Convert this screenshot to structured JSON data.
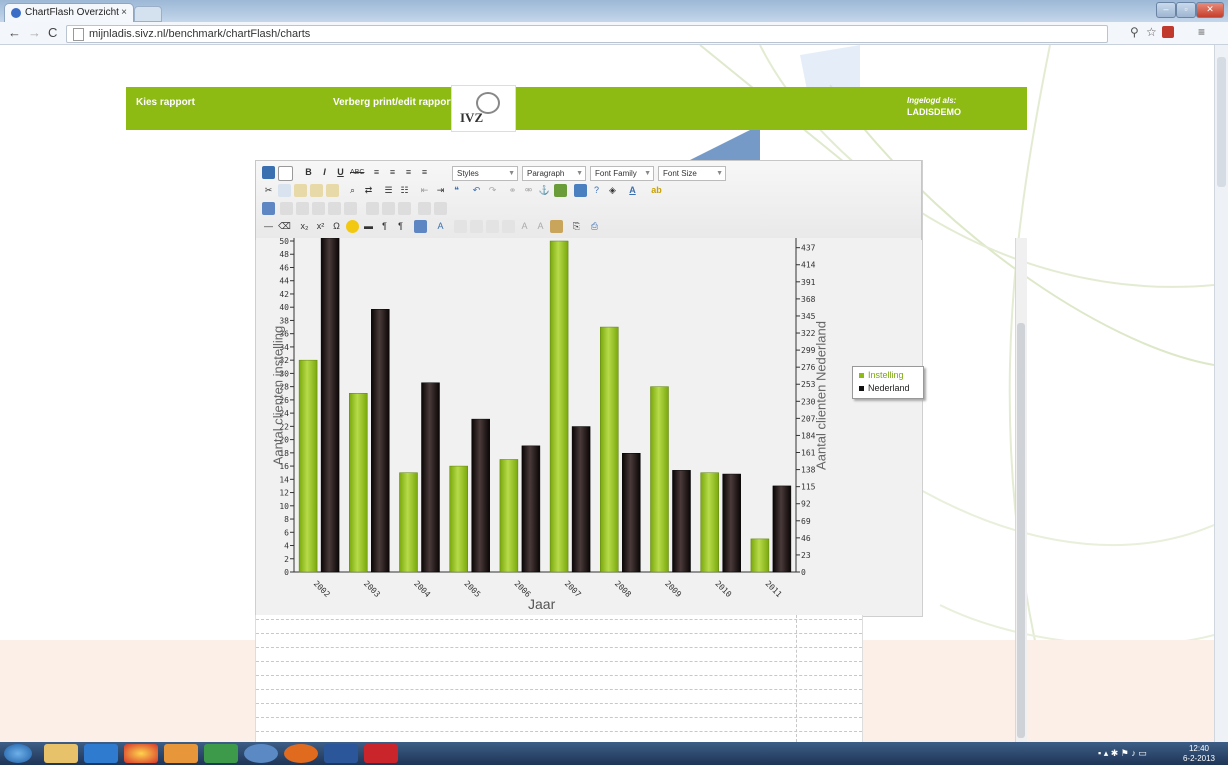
{
  "browser": {
    "tab_title": "ChartFlash Overzicht",
    "tab_close": "×",
    "url": "mijnladis.sivz.nl/benchmark/chartFlash/charts"
  },
  "header": {
    "left_link": "Kies rapport",
    "mid_link": "Verberg print/edit rapport",
    "logo_text": "IVZ",
    "login_label": "Ingelogd als:",
    "login_user": "LADISDEMO"
  },
  "editor": {
    "styles": "Styles",
    "paragraph": "Paragraph",
    "font_family": "Font Family",
    "font_size": "Font Size"
  },
  "chart_data": {
    "type": "bar",
    "xlabel": "Jaar",
    "ylabel": "Aantal clienten instelling",
    "y2label": "Aantal clienten Nederland",
    "categories": [
      "2002",
      "2003",
      "2004",
      "2005",
      "2006",
      "2007",
      "2008",
      "2009",
      "2010",
      "2011"
    ],
    "series": [
      {
        "name": "Instelling",
        "axis": "left",
        "color": "#8dbb14",
        "values": [
          32,
          27,
          15,
          16,
          17,
          50,
          37,
          28,
          15,
          5
        ]
      },
      {
        "name": "Nederland",
        "axis": "right",
        "color": "#1a1010",
        "values": [
          450,
          354,
          255,
          206,
          170,
          196,
          160,
          137,
          132,
          116
        ]
      }
    ],
    "ylim": [
      0,
      50
    ],
    "y2lim": [
      0,
      446
    ],
    "yticks": [
      "0",
      "2",
      "4",
      "6",
      "8",
      "10",
      "12",
      "14",
      "16",
      "18",
      "20",
      "22",
      "24",
      "26",
      "28",
      "30",
      "32",
      "34",
      "36",
      "38",
      "40",
      "42",
      "44",
      "46",
      "48",
      "50"
    ],
    "y2ticks": [
      "0",
      "23",
      "46",
      "69",
      "92",
      "115",
      "138",
      "161",
      "184",
      "207",
      "230",
      "253",
      "276",
      "299",
      "322",
      "345",
      "368",
      "391",
      "414",
      "437"
    ],
    "legend": "right"
  },
  "taskbar": {
    "time": "12:40",
    "date": "6-2-2013"
  }
}
